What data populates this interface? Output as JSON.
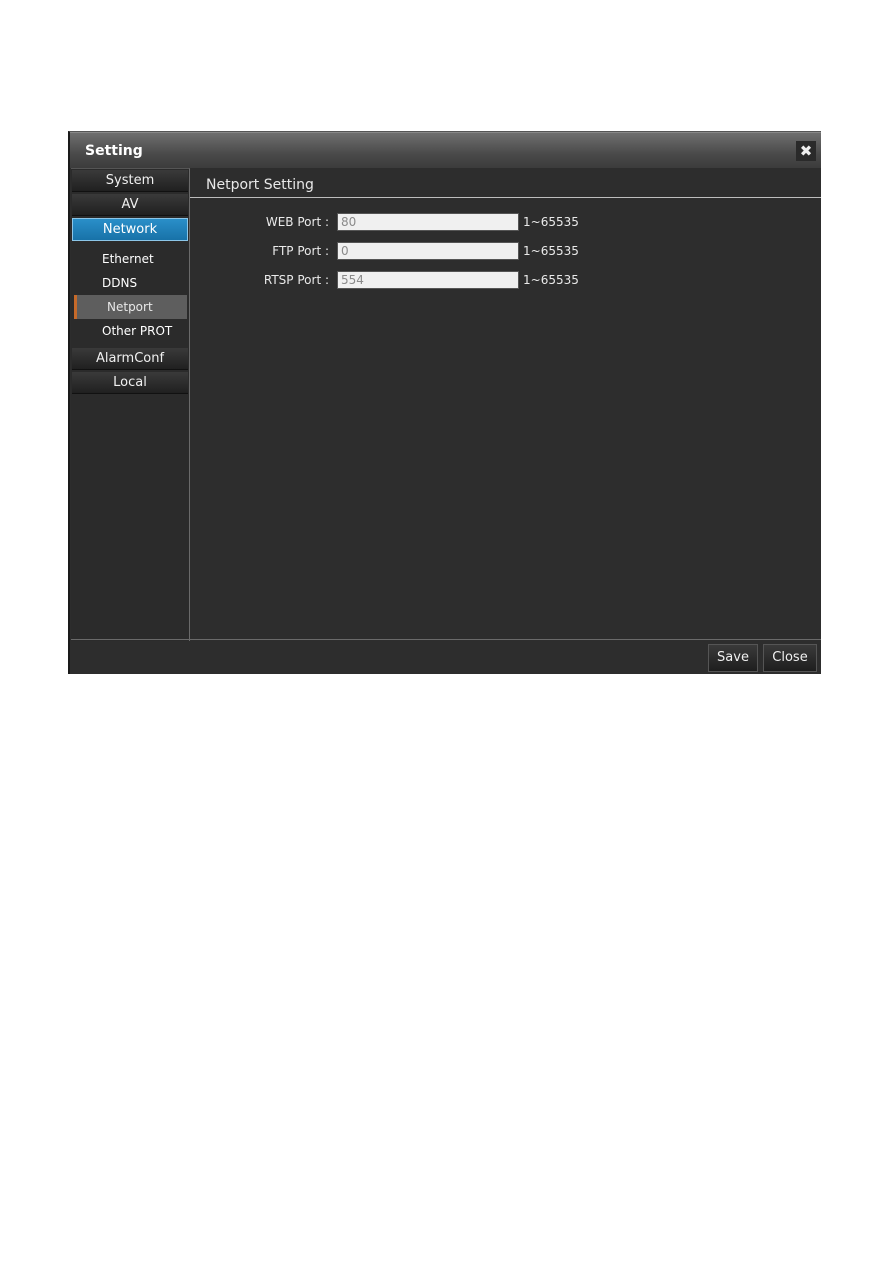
{
  "dialog": {
    "title": "Setting",
    "close_icon": "close-icon"
  },
  "sidebar": {
    "categories": [
      {
        "label": "System",
        "active": false
      },
      {
        "label": "AV",
        "active": false
      },
      {
        "label": "Network",
        "active": true
      },
      {
        "label": "AlarmConf",
        "active": false
      },
      {
        "label": "Local",
        "active": false
      }
    ],
    "network_items": [
      {
        "label": "Ethernet",
        "active": false
      },
      {
        "label": "DDNS",
        "active": false
      },
      {
        "label": "Netport",
        "active": true
      },
      {
        "label": "Other PROT",
        "active": false
      }
    ]
  },
  "main": {
    "title": "Netport Setting",
    "fields": [
      {
        "label": "WEB Port :",
        "value": "80",
        "range": "1~65535"
      },
      {
        "label": "FTP Port :",
        "value": "0",
        "range": "1~65535"
      },
      {
        "label": "RTSP Port :",
        "value": "554",
        "range": "1~65535"
      }
    ]
  },
  "footer": {
    "save_label": "Save",
    "close_label": "Close"
  },
  "colors": {
    "accent": "#1f84bd",
    "active_marker": "#c66a2a",
    "background": "#2d2d2d"
  }
}
